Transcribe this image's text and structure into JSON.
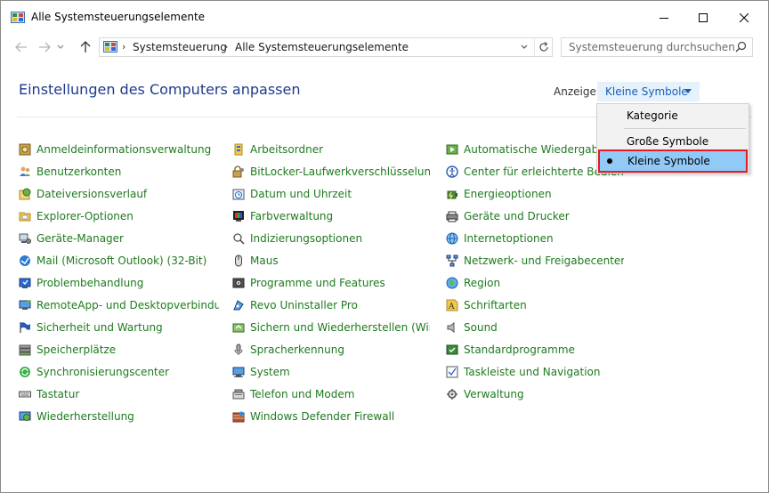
{
  "window": {
    "title": "Alle Systemsteuerungselemente"
  },
  "address": {
    "crumbs": [
      "Systemsteuerung",
      "Alle Systemsteuerungselemente"
    ]
  },
  "search": {
    "placeholder": "Systemsteuerung durchsuchen"
  },
  "header": {
    "title": "Einstellungen des Computers anpassen",
    "view_label": "Anzeige:",
    "view_value": "Kleine Symbole"
  },
  "view_menu": {
    "options": [
      "Kategorie",
      "Große Symbole",
      "Kleine Symbole"
    ],
    "selected": "Kleine Symbole"
  },
  "colors": {
    "link_green": "#1e7a1e",
    "title_blue": "#1e3a8c",
    "highlight_blue": "#91c9f7",
    "annotation_red": "#e01c24"
  },
  "columns": [
    [
      {
        "label": "Anmeldeinformationsverwaltung",
        "icon": "credential-vault-icon"
      },
      {
        "label": "Benutzerkonten",
        "icon": "users-icon"
      },
      {
        "label": "Dateiversionsverlauf",
        "icon": "file-history-icon"
      },
      {
        "label": "Explorer-Optionen",
        "icon": "folder-options-icon"
      },
      {
        "label": "Geräte-Manager",
        "icon": "device-manager-icon"
      },
      {
        "label": "Mail (Microsoft Outlook) (32-Bit)",
        "icon": "mail-icon"
      },
      {
        "label": "Problembehandlung",
        "icon": "troubleshoot-icon"
      },
      {
        "label": "RemoteApp- und Desktopverbindun...",
        "icon": "remote-desktop-icon"
      },
      {
        "label": "Sicherheit und Wartung",
        "icon": "flag-icon"
      },
      {
        "label": "Speicherplätze",
        "icon": "storage-spaces-icon"
      },
      {
        "label": "Synchronisierungscenter",
        "icon": "sync-icon"
      },
      {
        "label": "Tastatur",
        "icon": "keyboard-icon"
      },
      {
        "label": "Wiederherstellung",
        "icon": "recovery-icon"
      }
    ],
    [
      {
        "label": "Arbeitsordner",
        "icon": "work-folders-icon"
      },
      {
        "label": "BitLocker-Laufwerkverschlüsselung",
        "icon": "bitlocker-icon"
      },
      {
        "label": "Datum und Uhrzeit",
        "icon": "clock-icon"
      },
      {
        "label": "Farbverwaltung",
        "icon": "color-management-icon"
      },
      {
        "label": "Indizierungsoptionen",
        "icon": "indexing-icon"
      },
      {
        "label": "Maus",
        "icon": "mouse-icon"
      },
      {
        "label": "Programme und Features",
        "icon": "programs-icon"
      },
      {
        "label": "Revo Uninstaller Pro",
        "icon": "revo-uninstaller-icon"
      },
      {
        "label": "Sichern und Wiederherstellen (Wind...",
        "icon": "backup-icon"
      },
      {
        "label": "Spracherkennung",
        "icon": "microphone-icon"
      },
      {
        "label": "System",
        "icon": "system-icon"
      },
      {
        "label": "Telefon und Modem",
        "icon": "phone-modem-icon"
      },
      {
        "label": "Windows Defender Firewall",
        "icon": "firewall-icon"
      }
    ],
    [
      {
        "label": "Automatische Wiedergabe",
        "icon": "autoplay-icon"
      },
      {
        "label": "Center für erleichterte Bedienung",
        "icon": "ease-of-access-icon"
      },
      {
        "label": "Energieoptionen",
        "icon": "power-options-icon"
      },
      {
        "label": "Geräte und Drucker",
        "icon": "devices-printers-icon"
      },
      {
        "label": "Internetoptionen",
        "icon": "internet-options-icon"
      },
      {
        "label": "Netzwerk- und Freigabecenter",
        "icon": "network-icon"
      },
      {
        "label": "Region",
        "icon": "region-icon"
      },
      {
        "label": "Schriftarten",
        "icon": "fonts-icon"
      },
      {
        "label": "Sound",
        "icon": "speaker-icon"
      },
      {
        "label": "Standardprogramme",
        "icon": "default-programs-icon"
      },
      {
        "label": "Taskleiste und Navigation",
        "icon": "taskbar-icon"
      },
      {
        "label": "Verwaltung",
        "icon": "admin-tools-icon"
      }
    ]
  ]
}
